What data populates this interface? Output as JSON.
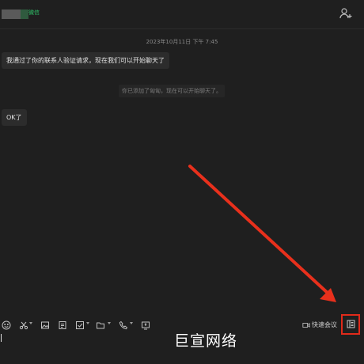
{
  "header": {
    "contact_tag": "微信",
    "add_user_icon": "add-user-icon"
  },
  "chat": {
    "timestamp": "2023年10月11日 下午 7:45",
    "messages": [
      {
        "text": "我通过了你的联系人验证请求，现在我们可以开始聊天了"
      },
      {
        "text": "OK了"
      }
    ],
    "system_notice": "你已添加了匈匈，现在可以开始聊天了。"
  },
  "toolbar": {
    "icons": [
      "emoji-icon",
      "scissors-icon",
      "image-icon",
      "file-icon",
      "checklist-icon",
      "folder-icon",
      "phone-icon",
      "screen-share-icon"
    ],
    "meeting_label": "快速会议",
    "sidebar_icon": "sidebar-toggle-icon"
  },
  "watermark": "巨宣网络",
  "colors": {
    "background": "#1f1f1f",
    "bubble": "#2c2c2c",
    "highlight": "#e02a1a",
    "tag_green": "#2fc36a"
  }
}
